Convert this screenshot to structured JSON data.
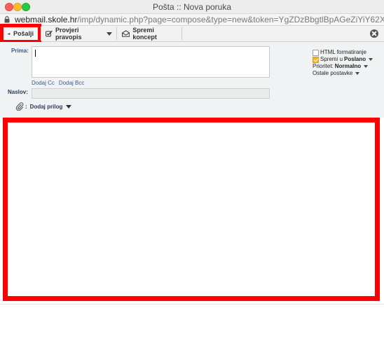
{
  "window": {
    "title": "Pošta :: Nova poruka"
  },
  "urlbar": {
    "host": "webmail.skole.hr",
    "path": "/imp/dynamic.php?page=compose&type=new&token=YgZDzBbgtlBpAGeZiYiY62X&uniq=158875..."
  },
  "toolbar": {
    "send_label": "Pošalji",
    "spellcheck_label": "Provjeri pravopis",
    "save_draft_label": "Spremi koncept"
  },
  "compose": {
    "to_label": "Prima:",
    "to_value": "",
    "add_cc": "Dodaj Cc",
    "add_bcc": "Dodaj Bcc",
    "subject_label": "Naslov:",
    "subject_value": "",
    "attach_separator": ":",
    "attach_label": "Dodaj prilog",
    "body_value": ""
  },
  "options": {
    "html_format_label": "HTML formatiranje",
    "html_format_checked": false,
    "save_in_label": "Spremi u",
    "save_in_value": "Poslano",
    "save_in_checked": true,
    "priority_label": "Prioritet:",
    "priority_value": "Normalno",
    "other_settings_label": "Ostale postavke"
  },
  "colors": {
    "highlight": "#ff0000",
    "checkbox_checked": "#f5b625",
    "label_blue": "#3a5b8c"
  }
}
